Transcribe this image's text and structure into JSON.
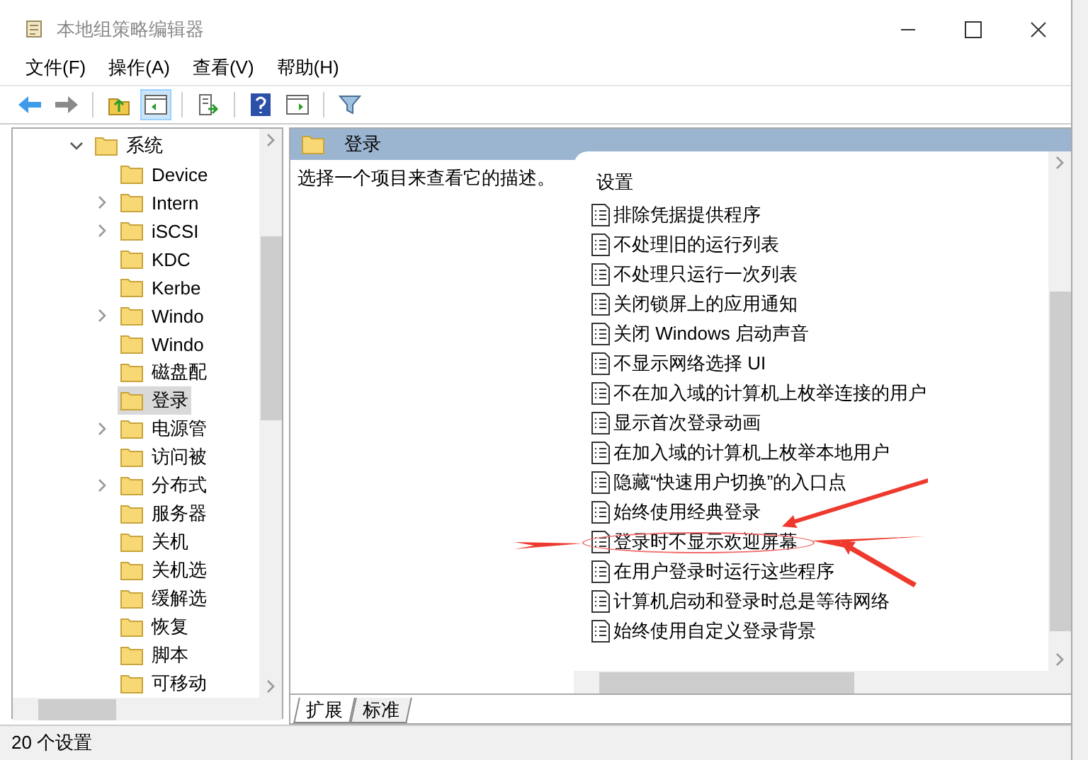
{
  "window": {
    "title": "本地组策略编辑器"
  },
  "menu": [
    "文件(F)",
    "操作(A)",
    "查看(V)",
    "帮助(H)"
  ],
  "tree": {
    "label": "系统",
    "expanded": true,
    "selected": false,
    "children": [
      {
        "label": "Device",
        "has_children": false,
        "selected": false
      },
      {
        "label": "Intern",
        "has_children": true,
        "selected": false
      },
      {
        "label": "iSCSI",
        "has_children": true,
        "selected": false
      },
      {
        "label": "KDC",
        "has_children": false,
        "selected": false
      },
      {
        "label": "Kerbe",
        "has_children": false,
        "selected": false
      },
      {
        "label": "Windo",
        "has_children": true,
        "selected": false
      },
      {
        "label": "Windo",
        "has_children": false,
        "selected": false
      },
      {
        "label": "磁盘配",
        "has_children": false,
        "selected": false
      },
      {
        "label": "登录",
        "has_children": false,
        "selected": true
      },
      {
        "label": "电源管",
        "has_children": true,
        "selected": false
      },
      {
        "label": "访问被",
        "has_children": false,
        "selected": false
      },
      {
        "label": "分布式",
        "has_children": true,
        "selected": false
      },
      {
        "label": "服务器",
        "has_children": false,
        "selected": false
      },
      {
        "label": "关机",
        "has_children": false,
        "selected": false
      },
      {
        "label": "关机选",
        "has_children": false,
        "selected": false
      },
      {
        "label": "缓解选",
        "has_children": false,
        "selected": false
      },
      {
        "label": "恢复",
        "has_children": false,
        "selected": false
      },
      {
        "label": "脚本",
        "has_children": false,
        "selected": false
      },
      {
        "label": "可移动",
        "has_children": false,
        "selected": false
      }
    ]
  },
  "content": {
    "header": "登录",
    "description": "选择一个项目来查看它的描述。",
    "column": "设置",
    "settings": [
      {
        "name": "排除凭据提供程序",
        "circled": false
      },
      {
        "name": "不处理旧的运行列表",
        "circled": false
      },
      {
        "name": "不处理只运行一次列表",
        "circled": false
      },
      {
        "name": "关闭锁屏上的应用通知",
        "circled": false
      },
      {
        "name": "关闭 Windows 启动声音",
        "circled": false
      },
      {
        "name": "不显示网络选择 UI",
        "circled": false
      },
      {
        "name": "不在加入域的计算机上枚举连接的用户",
        "circled": false
      },
      {
        "name": "显示首次登录动画",
        "circled": false
      },
      {
        "name": "在加入域的计算机上枚举本地用户",
        "circled": false
      },
      {
        "name": "隐藏“快速用户切换”的入口点",
        "circled": false
      },
      {
        "name": "始终使用经典登录",
        "circled": false
      },
      {
        "name": "登录时不显示欢迎屏幕",
        "circled": true
      },
      {
        "name": "在用户登录时运行这些程序",
        "circled": false
      },
      {
        "name": "计算机启动和登录时总是等待网络",
        "circled": false
      },
      {
        "name": "始终使用自定义登录背景",
        "circled": false
      }
    ]
  },
  "tabs": [
    {
      "label": "扩展",
      "selected": true
    },
    {
      "label": "标准",
      "selected": false
    }
  ],
  "status_bar": "20 个设置"
}
